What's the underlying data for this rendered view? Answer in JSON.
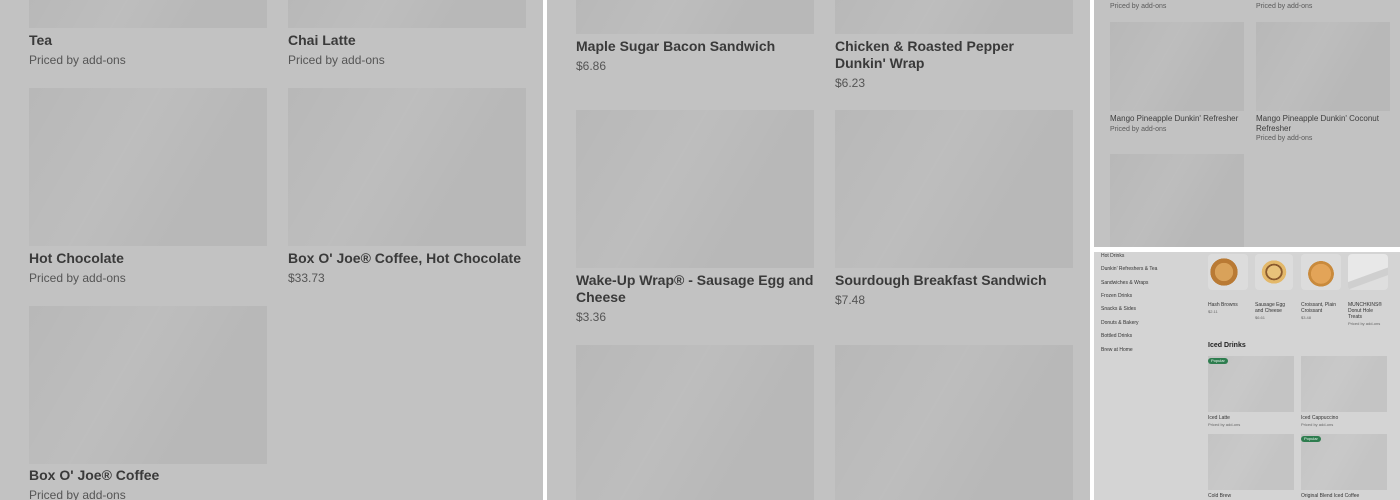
{
  "panel1": {
    "cards": [
      {
        "title": "Tea",
        "price": "Priced by add-ons"
      },
      {
        "title": "Chai Latte",
        "price": "Priced by add-ons"
      },
      {
        "title": "Hot Chocolate",
        "price": "Priced by add-ons"
      },
      {
        "title": "Box O' Joe® Coffee, Hot Chocolate",
        "price": "$33.73"
      },
      {
        "title": "Box O' Joe® Coffee",
        "price": "Priced by add-ons"
      }
    ]
  },
  "panel2": {
    "cards": [
      {
        "title": "Maple Sugar Bacon Sandwich",
        "price": "$6.86"
      },
      {
        "title": "Chicken & Roasted Pepper Dunkin' Wrap",
        "price": "$6.23"
      },
      {
        "title": "Wake-Up Wrap® - Sausage Egg and Cheese",
        "price": "$3.36"
      },
      {
        "title": "Sourdough Breakfast Sandwich",
        "price": "$7.48"
      }
    ]
  },
  "panel3": {
    "top_prices": [
      "Priced by add-ons",
      "Priced by add-ons"
    ],
    "cards": [
      {
        "title": "Mango Pineapple Dunkin' Refresher",
        "price": "Priced by add-ons"
      },
      {
        "title": "Mango Pineapple Dunkin' Coconut Refresher",
        "price": "Priced by add-ons"
      }
    ]
  },
  "panel4": {
    "nav": [
      "Hot Drinks",
      "Dunkin' Refreshers & Tea",
      "Sandwiches & Wraps",
      "Frozen Drinks",
      "Snacks & Sides",
      "Donuts & Bakery",
      "Bottled Drinks",
      "Brew at Home"
    ],
    "top_items": [
      {
        "title": "Hash Browns",
        "price": "$2.11"
      },
      {
        "title": "Sausage Egg and Cheese",
        "price": "$6.61"
      },
      {
        "title": "Croissant, Plain Croissant",
        "price": "$3.48"
      },
      {
        "title": "MUNCHKINS® Donut Hole Treats",
        "price": "Priced by add-ons"
      }
    ],
    "section_title": "Iced Drinks",
    "badge": "Popular",
    "cards": [
      {
        "title": "Iced Latte",
        "price": "Priced by add-ons"
      },
      {
        "title": "Iced Cappuccino",
        "price": "Priced by add-ons"
      },
      {
        "title": "Cold Brew",
        "price": ""
      },
      {
        "title": "Original Blend Iced Coffee",
        "price": ""
      }
    ]
  }
}
